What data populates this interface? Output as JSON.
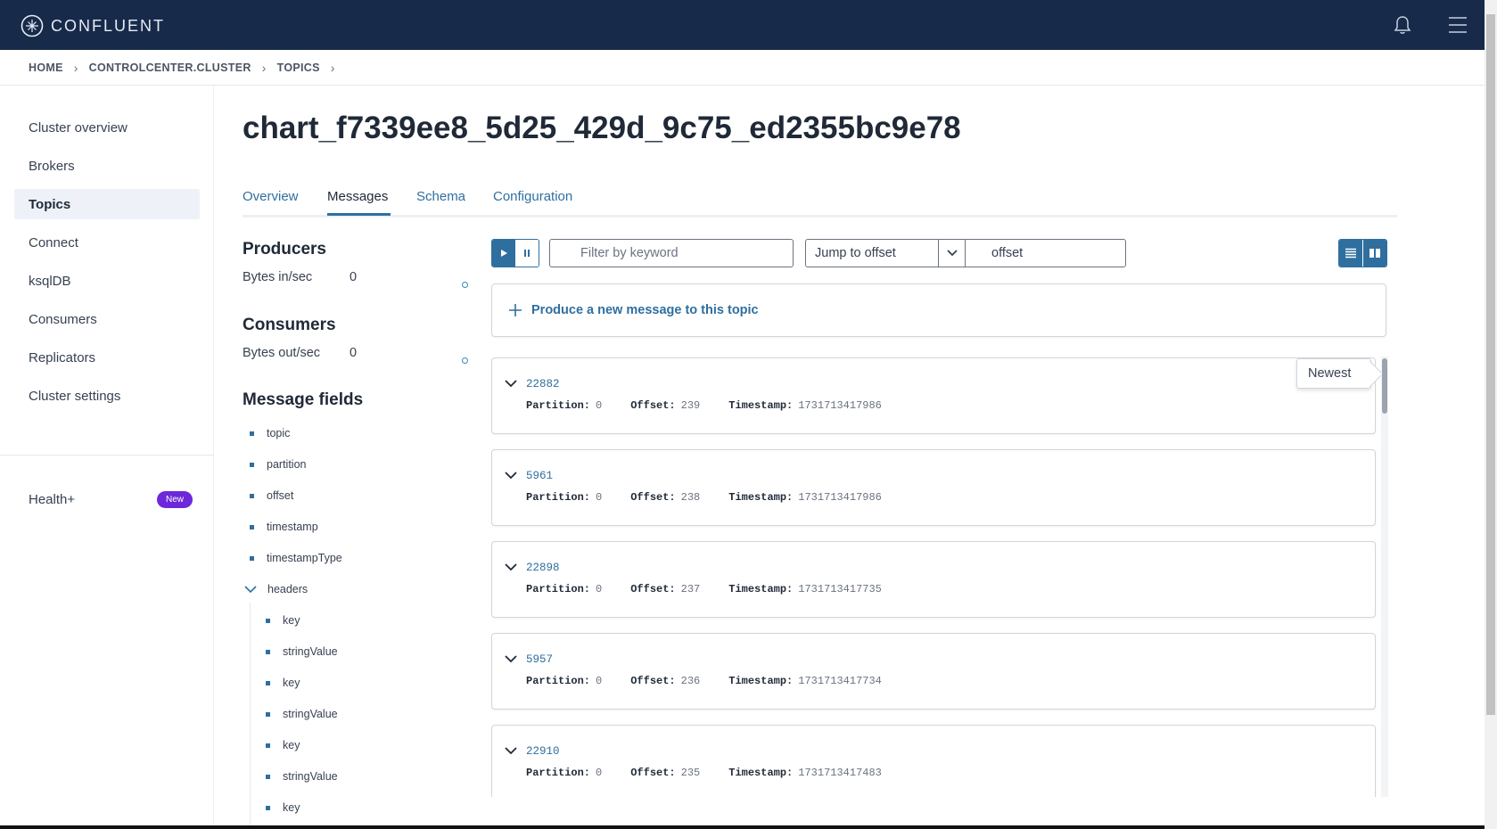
{
  "app": {
    "logo_text": "CONFLUENT"
  },
  "breadcrumb": [
    "HOME",
    "CONTROLCENTER.CLUSTER",
    "TOPICS"
  ],
  "sidebar": {
    "items": [
      {
        "label": "Cluster overview",
        "active": false
      },
      {
        "label": "Brokers",
        "active": false
      },
      {
        "label": "Topics",
        "active": true
      },
      {
        "label": "Connect",
        "active": false
      },
      {
        "label": "ksqlDB",
        "active": false
      },
      {
        "label": "Consumers",
        "active": false
      },
      {
        "label": "Replicators",
        "active": false
      },
      {
        "label": "Cluster settings",
        "active": false
      }
    ],
    "health": {
      "label": "Health+",
      "badge": "New"
    }
  },
  "page": {
    "title": "chart_f7339ee8_5d25_429d_9c75_ed2355bc9e78",
    "tabs": [
      {
        "label": "Overview",
        "active": false
      },
      {
        "label": "Messages",
        "active": true
      },
      {
        "label": "Schema",
        "active": false
      },
      {
        "label": "Configuration",
        "active": false
      }
    ]
  },
  "producers": {
    "heading": "Producers",
    "label": "Bytes in/sec",
    "value": "0"
  },
  "consumers": {
    "heading": "Consumers",
    "label": "Bytes out/sec",
    "value": "0"
  },
  "message_fields": {
    "heading": "Message fields",
    "fields": [
      "topic",
      "partition",
      "offset",
      "timestamp",
      "timestampType"
    ],
    "headers_label": "headers",
    "header_fields": [
      "key",
      "stringValue",
      "key",
      "stringValue",
      "key",
      "stringValue",
      "key"
    ]
  },
  "toolbar": {
    "filter_placeholder": "Filter by keyword",
    "jump_label": "Jump to offset",
    "offset_value": "offset"
  },
  "produce": {
    "label": "Produce a new message to this topic"
  },
  "newest_label": "Newest",
  "meta_labels": {
    "partition": "Partition:",
    "offset": "Offset:",
    "timestamp": "Timestamp:"
  },
  "messages": [
    {
      "key": "22882",
      "partition": "0",
      "offset": "239",
      "timestamp": "1731713417986"
    },
    {
      "key": "5961",
      "partition": "0",
      "offset": "238",
      "timestamp": "1731713417986"
    },
    {
      "key": "22898",
      "partition": "0",
      "offset": "237",
      "timestamp": "1731713417735"
    },
    {
      "key": "5957",
      "partition": "0",
      "offset": "236",
      "timestamp": "1731713417734"
    },
    {
      "key": "22910",
      "partition": "0",
      "offset": "235",
      "timestamp": "1731713417483"
    }
  ],
  "colors": {
    "nav_bg": "#172a4a",
    "accent": "#2f6f9f",
    "badge": "#6d28d9"
  }
}
